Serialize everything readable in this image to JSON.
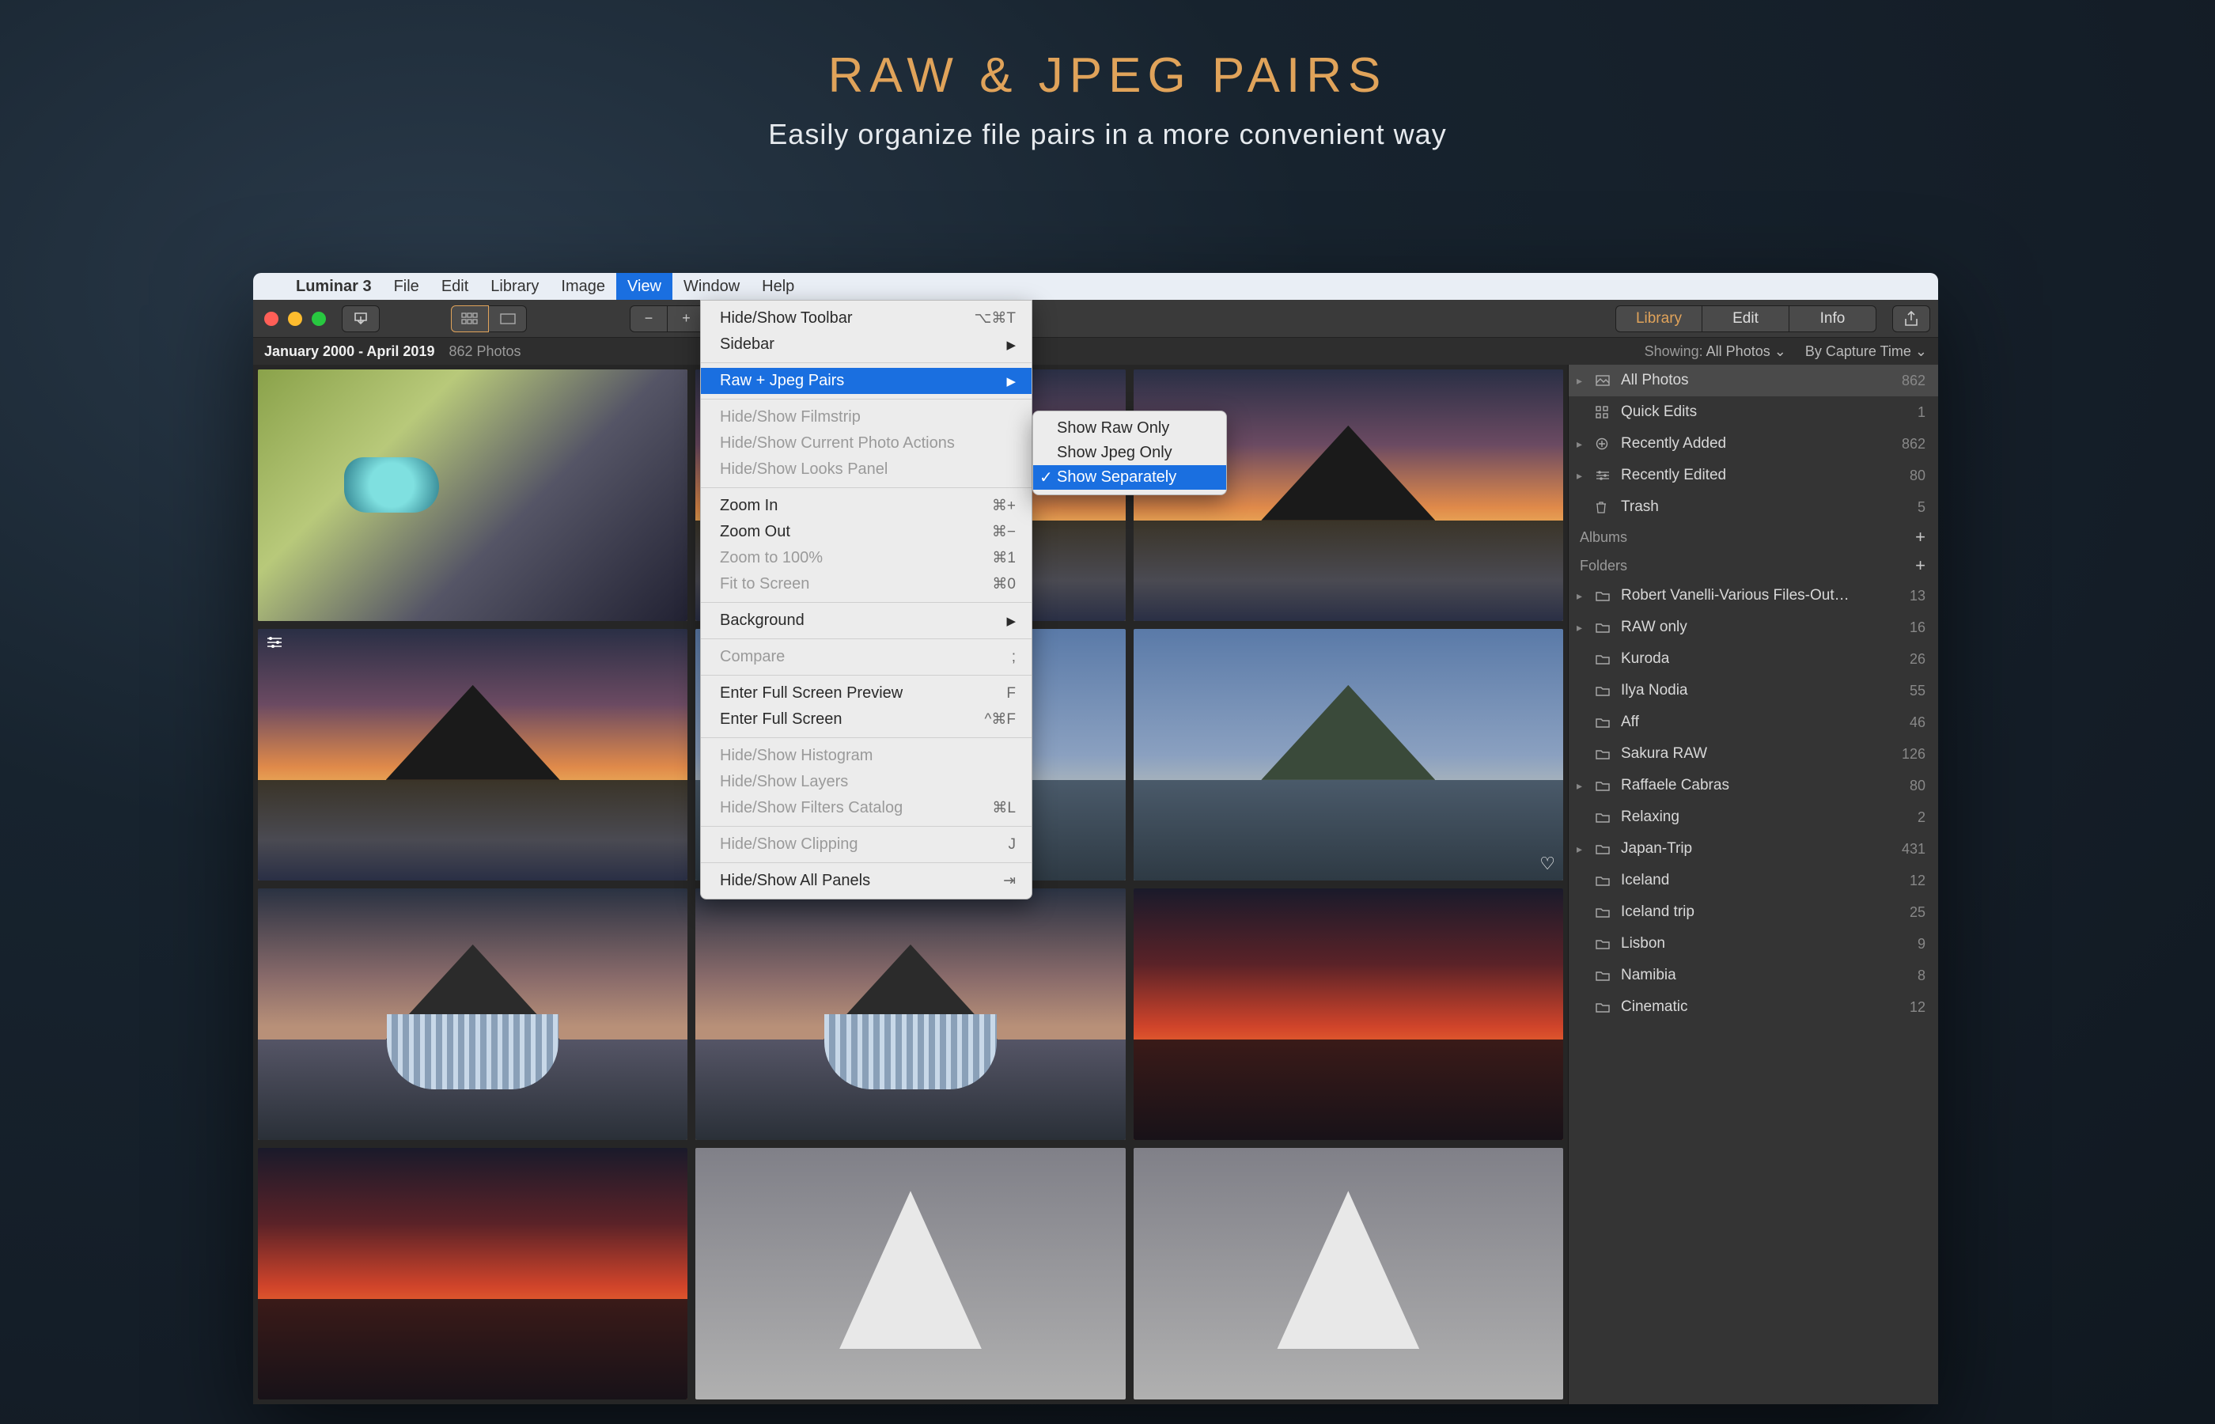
{
  "promo": {
    "title": "RAW & JPEG PAIRS",
    "subtitle": "Easily organize file pairs in a more convenient way"
  },
  "menubar": {
    "app": "Luminar 3",
    "items": [
      "File",
      "Edit",
      "Library",
      "Image",
      "View",
      "Window",
      "Help"
    ],
    "selected": "View"
  },
  "toolbar": {
    "tabs": {
      "library": "Library",
      "edit": "Edit",
      "info": "Info",
      "selected": "Library"
    }
  },
  "header": {
    "page_title": "All Photos",
    "date_range": "January 2000 - April 2019",
    "photo_count": "862 Photos",
    "showing_label": "Showing:",
    "showing_value": "All Photos",
    "sort_label": "By Capture Time"
  },
  "view_menu": {
    "hide_show_toolbar": {
      "label": "Hide/Show Toolbar",
      "shortcut": "⌥⌘T"
    },
    "sidebar": {
      "label": "Sidebar"
    },
    "raw_jpeg_pairs": {
      "label": "Raw + Jpeg Pairs"
    },
    "hide_show_filmstrip": {
      "label": "Hide/Show Filmstrip"
    },
    "hide_show_actions": {
      "label": "Hide/Show Current Photo Actions"
    },
    "hide_show_looks": {
      "label": "Hide/Show Looks Panel"
    },
    "zoom_in": {
      "label": "Zoom In",
      "shortcut": "⌘+"
    },
    "zoom_out": {
      "label": "Zoom Out",
      "shortcut": "⌘−"
    },
    "zoom_100": {
      "label": "Zoom to 100%",
      "shortcut": "⌘1"
    },
    "fit_screen": {
      "label": "Fit to Screen",
      "shortcut": "⌘0"
    },
    "background": {
      "label": "Background"
    },
    "compare": {
      "label": "Compare",
      "shortcut": ";"
    },
    "fullscreen_preview": {
      "label": "Enter Full Screen Preview",
      "shortcut": "F"
    },
    "fullscreen": {
      "label": "Enter Full Screen",
      "shortcut": "^⌘F"
    },
    "histogram": {
      "label": "Hide/Show Histogram"
    },
    "layers": {
      "label": "Hide/Show Layers"
    },
    "filters_catalog": {
      "label": "Hide/Show Filters Catalog",
      "shortcut": "⌘L"
    },
    "clipping": {
      "label": "Hide/Show Clipping",
      "shortcut": "J"
    },
    "all_panels": {
      "label": "Hide/Show All Panels",
      "shortcut": "⇥"
    }
  },
  "raw_jpeg_submenu": {
    "raw_only": "Show Raw Only",
    "jpeg_only": "Show Jpeg Only",
    "separately": "Show Separately"
  },
  "sidebar": {
    "shortcuts": [
      {
        "label": "All Photos",
        "count": "862",
        "icon": "photo",
        "selected": true,
        "disclose": true
      },
      {
        "label": "Quick Edits",
        "count": "1",
        "icon": "grid",
        "selected": false,
        "disclose": false
      },
      {
        "label": "Recently Added",
        "count": "862",
        "icon": "plus-circle",
        "selected": false,
        "disclose": true
      },
      {
        "label": "Recently Edited",
        "count": "80",
        "icon": "sliders",
        "selected": false,
        "disclose": true
      },
      {
        "label": "Trash",
        "count": "5",
        "icon": "trash",
        "selected": false,
        "disclose": false
      }
    ],
    "albums_header": "Albums",
    "folders_header": "Folders",
    "folders": [
      {
        "label": "Robert Vanelli-Various Files-Out…",
        "count": "13",
        "disclose": true
      },
      {
        "label": "RAW only",
        "count": "16",
        "disclose": true
      },
      {
        "label": "Kuroda",
        "count": "26"
      },
      {
        "label": "Ilya Nodia",
        "count": "55"
      },
      {
        "label": "Aff",
        "count": "46"
      },
      {
        "label": "Sakura RAW",
        "count": "126"
      },
      {
        "label": "Raffaele Cabras",
        "count": "80",
        "disclose": true
      },
      {
        "label": "Relaxing",
        "count": "2"
      },
      {
        "label": "Japan-Trip",
        "count": "431",
        "disclose": true
      },
      {
        "label": "Iceland",
        "count": "12"
      },
      {
        "label": "Iceland trip",
        "count": "25"
      },
      {
        "label": "Lisbon",
        "count": "9"
      },
      {
        "label": "Namibia",
        "count": "8"
      },
      {
        "label": "Cinematic",
        "count": "12"
      }
    ]
  }
}
